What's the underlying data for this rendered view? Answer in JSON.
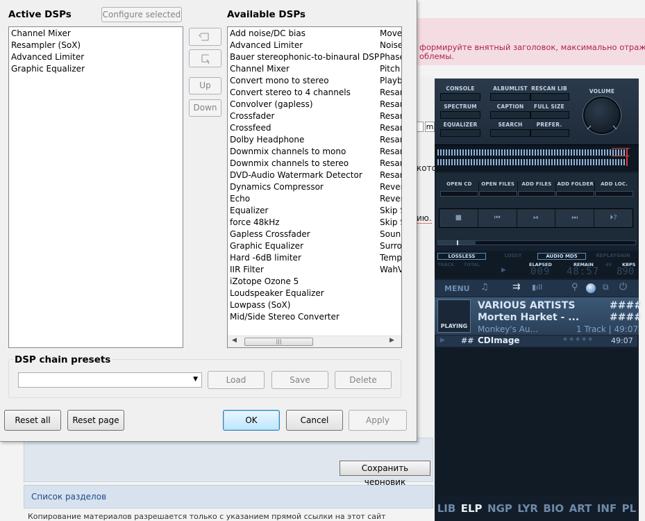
{
  "background": {
    "pink_line1": "формируйте внятный заголовок, максимально отражаю",
    "pink_line2": "облемы.",
    "frag_kotor": "кото",
    "frag_yu": "ию.",
    "save_draft": "Сохранить черновик",
    "sections_link": "Список разделов",
    "footer": "Копирование материалов разрешается только с указанием прямой ссылки на этот сайт"
  },
  "dialog": {
    "active_title": "Active DSPs",
    "configure_label": "Configure selected",
    "available_title": "Available DSPs",
    "active_items": [
      "Channel Mixer",
      "Resampler (SoX)",
      "Advanced Limiter",
      "Graphic Equalizer"
    ],
    "available_items": [
      [
        "Add noise/DC bias",
        "Move"
      ],
      [
        "Advanced Limiter",
        "Noise"
      ],
      [
        "Bauer stereophonic-to-binaural DSP",
        "Phase"
      ],
      [
        "Channel Mixer",
        "Pitch"
      ],
      [
        "Convert mono to stereo",
        "Playb"
      ],
      [
        "Convert stereo to 4 channels",
        "Resar"
      ],
      [
        "Convolver (gapless)",
        "Resar"
      ],
      [
        "Crossfader",
        "Resar"
      ],
      [
        "Crossfeed",
        "Resar"
      ],
      [
        "Dolby Headphone",
        "Resar"
      ],
      [
        "Downmix channels to mono",
        "Resar"
      ],
      [
        "Downmix channels to stereo",
        "Resar"
      ],
      [
        "DVD-Audio Watermark Detector",
        "Resar"
      ],
      [
        "Dynamics Compressor",
        "Rever"
      ],
      [
        "Echo",
        "Rever"
      ],
      [
        "Equalizer",
        "Skip S"
      ],
      [
        "force 48kHz",
        "Skip S"
      ],
      [
        "Gapless Crossfader",
        "Soun"
      ],
      [
        "Graphic Equalizer",
        "Surro"
      ],
      [
        "Hard -6dB limiter",
        "Temp"
      ],
      [
        "IIR Filter",
        "WahV"
      ],
      [
        "iZotope Ozone 5",
        ""
      ],
      [
        "Loudspeaker Equalizer",
        ""
      ],
      [
        "Lowpass (SoX)",
        ""
      ],
      [
        "Mid/Side Stereo Converter",
        ""
      ]
    ],
    "up_label": "Up",
    "down_label": "Down",
    "presets_title": "DSP chain presets",
    "load_label": "Load",
    "save_label": "Save",
    "delete_label": "Delete",
    "reset_all": "Reset all",
    "reset_page": "Reset page",
    "ok": "OK",
    "cancel": "Cancel",
    "apply": "Apply"
  },
  "player": {
    "btns_row1": [
      "CONSOLE",
      "ALBUMLIST",
      "RESCAN LIB"
    ],
    "btns_row2": [
      "SPECTRUM",
      "CAPTION",
      "FULL SIZE"
    ],
    "btns_row3": [
      "EQUALIZER",
      "SEARCH",
      "PREFER."
    ],
    "volume": "VOLUME",
    "file_btns": [
      "OPEN CD",
      "OPEN FILES",
      "ADD FILES",
      "ADD FOLDER",
      "ADD LOC."
    ],
    "transport": [
      "■",
      "⏮",
      "⏯",
      "⏭",
      "⏵?"
    ],
    "badges": [
      "LOSSLESS",
      "LOSSY",
      "AUDIO MD5",
      "REPLAYGAIN"
    ],
    "stat_labels": [
      "TRACK",
      "TOTAL",
      "ELAPSED",
      "REMAIN",
      "4S",
      "KBPS"
    ],
    "stat_values": [
      "009",
      "48:57",
      "890"
    ],
    "menu": "MENU",
    "artist": "VARIOUS ARTISTS",
    "artist_hash": "####",
    "track": "Morten Harket - ...",
    "track_hash": "####",
    "album": "Monkey's Au...",
    "album_info": "1 Track | 49:07",
    "playing": "PLAYING",
    "row_num": "##",
    "row_title": "CDImage",
    "row_stars": "★★★★★",
    "row_time": "49:07",
    "nav": [
      "LIB",
      "ELP",
      "NGP",
      "LYR",
      "BIO",
      "ART",
      "INF",
      "PL"
    ]
  }
}
